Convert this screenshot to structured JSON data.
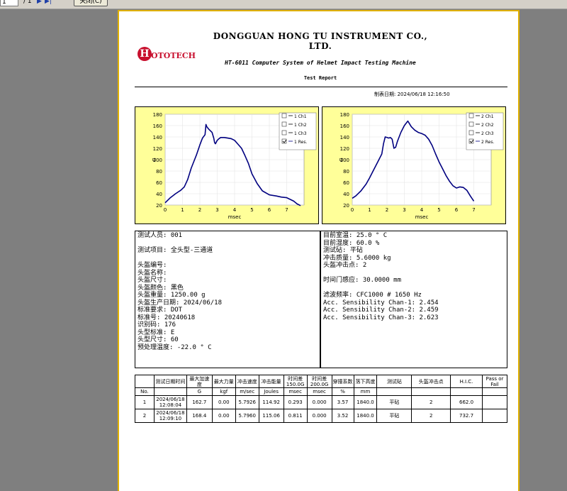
{
  "toolbar": {
    "page_value": "1",
    "page_total": "/ 1",
    "close_label": "关闭(C)"
  },
  "report": {
    "company": "DONGGUAN HONG TU INSTRUMENT CO., LTD.",
    "logo_letter": "H",
    "logo_text": "OTOTECH",
    "subtitle": "HT-6011 Computer System of Helmet Impact Testing Machine",
    "report_title": "Test Report",
    "print_date": "制表日期: 2024/06/18 12:16:50"
  },
  "charts": [
    {
      "legend": [
        "1 Ch1",
        "1 Ch2",
        "1 Ch3",
        "1 Res."
      ],
      "checked": [
        false,
        false,
        false,
        true
      ]
    },
    {
      "legend": [
        "2 Ch1",
        "2 Ch2",
        "2 Ch3",
        "2 Res."
      ],
      "checked": [
        false,
        false,
        false,
        true
      ]
    }
  ],
  "chart_data": [
    {
      "type": "line",
      "ylabel": "G",
      "xlabel": "msec",
      "xlim": [
        0,
        8
      ],
      "ylim": [
        20,
        180
      ],
      "xticks": [
        0,
        1,
        2,
        3,
        4,
        5,
        6,
        7
      ],
      "yticks": [
        20,
        40,
        60,
        80,
        100,
        120,
        140,
        160,
        180
      ],
      "grid": true,
      "series": [
        {
          "name": "1 Res.",
          "color": "#000080",
          "x": [
            0,
            0.3,
            0.6,
            0.9,
            1.1,
            1.3,
            1.5,
            1.8,
            2.0,
            2.15,
            2.3,
            2.35,
            2.4,
            2.5,
            2.6,
            2.7,
            2.8,
            2.85,
            2.9,
            3.0,
            3.1,
            3.2,
            3.4,
            3.6,
            3.8,
            4.0,
            4.2,
            4.4,
            4.6,
            4.8,
            5.0,
            5.3,
            5.6,
            6.0,
            6.4,
            6.7,
            7.0,
            7.2,
            7.4,
            7.6,
            7.8
          ],
          "y": [
            24,
            33,
            40,
            46,
            52,
            65,
            85,
            108,
            126,
            138,
            144,
            162,
            158,
            154,
            151,
            148,
            138,
            130,
            128,
            134,
            137,
            139,
            139,
            138,
            137,
            134,
            127,
            120,
            107,
            93,
            75,
            58,
            45,
            38,
            36,
            34,
            33,
            30,
            27,
            22,
            19
          ]
        }
      ]
    },
    {
      "type": "line",
      "ylabel": "G",
      "xlabel": "msec",
      "xlim": [
        0,
        8
      ],
      "ylim": [
        20,
        180
      ],
      "xticks": [
        0,
        1,
        2,
        3,
        4,
        5,
        6,
        7
      ],
      "yticks": [
        20,
        40,
        60,
        80,
        100,
        120,
        140,
        160,
        180
      ],
      "grid": true,
      "series": [
        {
          "name": "2 Res.",
          "color": "#000080",
          "x": [
            0,
            0.2,
            0.5,
            0.8,
            1.0,
            1.2,
            1.5,
            1.7,
            1.8,
            1.9,
            2.0,
            2.1,
            2.2,
            2.3,
            2.4,
            2.5,
            2.6,
            2.8,
            3.0,
            3.2,
            3.4,
            3.6,
            3.8,
            4.0,
            4.2,
            4.4,
            4.6,
            4.8,
            5.0,
            5.2,
            5.4,
            5.6,
            5.8,
            6.0,
            6.2,
            6.4,
            6.6,
            6.8,
            7.0
          ],
          "y": [
            32,
            36,
            45,
            57,
            68,
            80,
            98,
            110,
            128,
            140,
            139,
            138,
            139,
            136,
            120,
            122,
            132,
            148,
            160,
            168,
            158,
            152,
            148,
            146,
            143,
            136,
            125,
            110,
            96,
            84,
            72,
            62,
            54,
            50,
            52,
            51,
            46,
            36,
            27
          ]
        }
      ]
    }
  ],
  "info_left": [
    "测试人员: 001",
    "",
    "测试项目: 全头型-三通道",
    "",
    "头盔编号:",
    "头盔名称:",
    "头盔尺寸:",
    "头盔颜色: 黑色",
    "头盔重量: 1250.00 g",
    "头盔生产日期: 2024/06/18",
    "标准要求: DOT",
    "标准号: 20240618",
    "识别码: 176",
    "头型标准: E",
    "头型尺寸: 60",
    "预处理温度: -22.0 ° C"
  ],
  "info_right": [
    "目前室温: 25.0 ° C",
    "目前湿度: 60.0 %",
    "测试砧: 平砧",
    "冲击质量: 5.6000 kg",
    "头盔冲击点: 2",
    "",
    "时间门感应: 30.0000 mm",
    "",
    "滤波频率: CFC1000 # 1650 Hz",
    "Acc. Sensibility Chan-1: 2.454",
    "Acc. Sensibility Chan-2: 2.459",
    "Acc. Sensibility Chan-3: 2.623"
  ],
  "table": {
    "headers": [
      "",
      "测试日期时间",
      "最大加速度",
      "最大力量",
      "冲击速度",
      "冲击能量",
      "时间差150.0G",
      "时间差200.0G",
      "穿撞系数",
      "落下高度",
      "测试砧",
      "头盔冲击点",
      "H.I.C.",
      "Pass or Fail"
    ],
    "units": [
      "No.",
      "",
      "G",
      "kgf",
      "m/sec",
      "Joules",
      "msec",
      "msec",
      "%",
      "mm",
      "",
      "",
      "",
      ""
    ],
    "rows": [
      [
        "1",
        "2024/06/18 12:08:04",
        "162.7",
        "0.00",
        "5.7926",
        "114.92",
        "0.293",
        "0.000",
        "3.57",
        "1840.0",
        "平砧",
        "2",
        "662.0",
        ""
      ],
      [
        "2",
        "2024/06/18 12:09:10",
        "168.4",
        "0.00",
        "5.7960",
        "115.06",
        "0.811",
        "0.000",
        "3.52",
        "1840.0",
        "平砧",
        "2",
        "732.7",
        ""
      ]
    ]
  }
}
